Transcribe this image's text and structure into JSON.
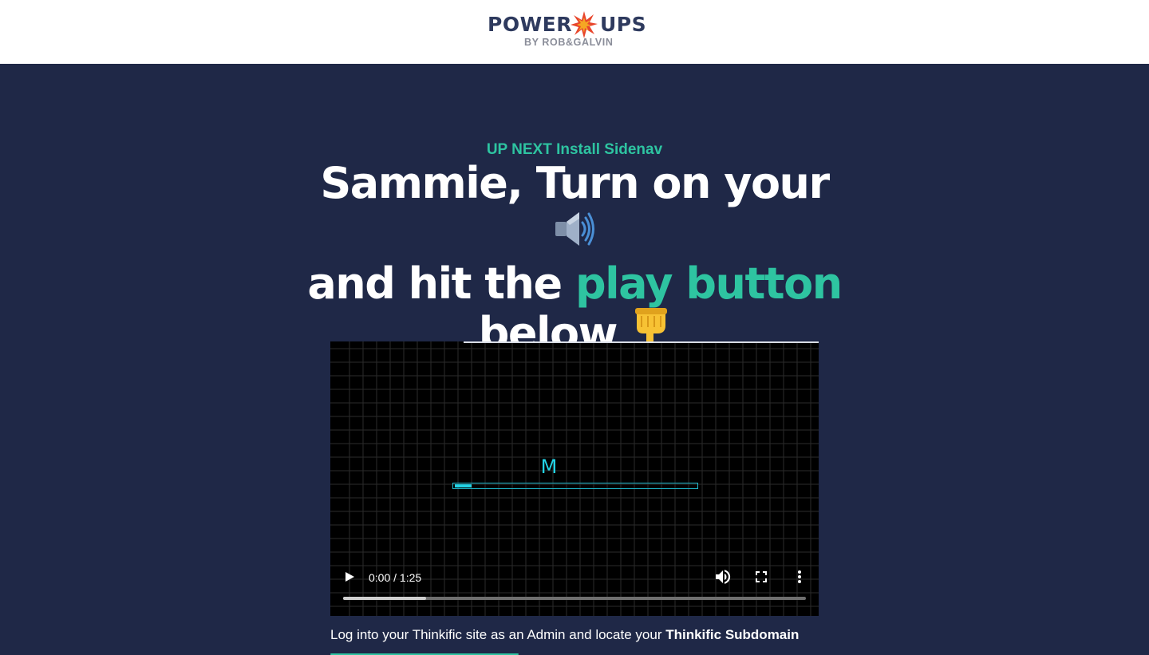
{
  "brand": {
    "logo_word1": "POWER",
    "logo_word2": "UPS",
    "logo_sub": "BY ROB&GALVIN",
    "navy": "#2e3a5e",
    "burst_colors": [
      "#e8452c",
      "#f5a623"
    ]
  },
  "hero": {
    "up_next": "UP NEXT Install Sidenav",
    "headline_part1": "Sammie, Turn on your",
    "headline_part2": "and hit the",
    "headline_accent": "play button",
    "headline_part3": "below",
    "speaker_icon": "speaker-icon",
    "pointing_icon": "pointing-down-icon",
    "accent_color": "#2ec4a1",
    "background": "#1f2847"
  },
  "video": {
    "loader_letter": "M",
    "loader_progress": 0.07,
    "time": "0:00 / 1:25",
    "buffered": 0.18,
    "icons": [
      "play-icon",
      "volume-icon",
      "fullscreen-icon",
      "more-vert-icon"
    ]
  },
  "caption": {
    "text": "Log into your Thinkific site as an Admin and locate your ",
    "bold": "Thinkific Subdomain"
  }
}
